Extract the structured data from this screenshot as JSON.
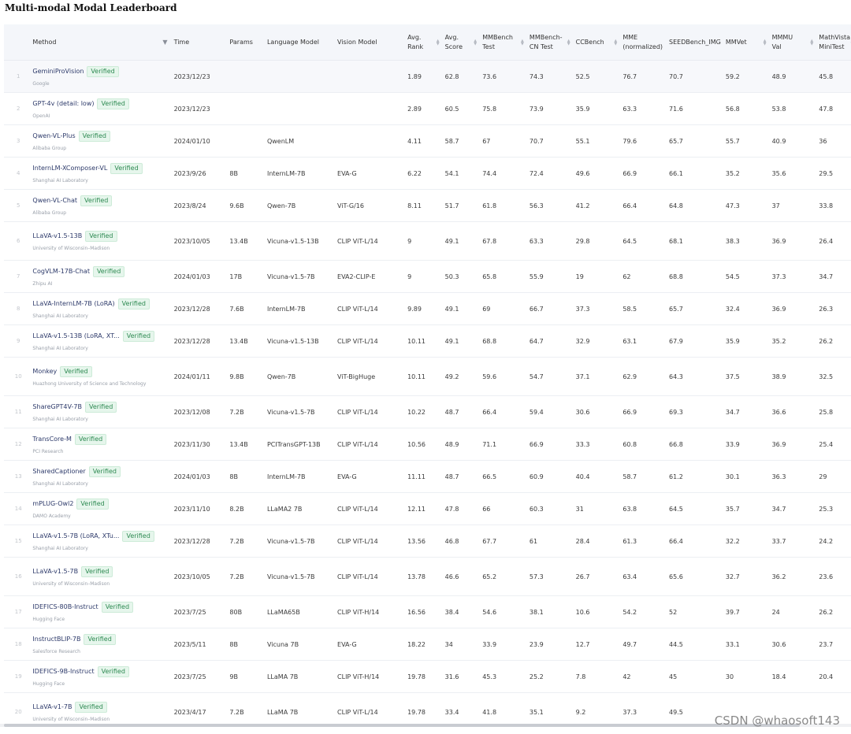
{
  "title": "Multi-modal Modal Leaderboard",
  "columns": [
    {
      "key": "method",
      "label": "Method",
      "filter": true
    },
    {
      "key": "time",
      "label": "Time"
    },
    {
      "key": "params",
      "label": "Params"
    },
    {
      "key": "lm",
      "label": "Language Model"
    },
    {
      "key": "vm",
      "label": "Vision Model"
    },
    {
      "key": "avg_rank",
      "label": "Avg.\nRank",
      "sort": true
    },
    {
      "key": "avg_score",
      "label": "Avg.\nScore",
      "sort": true
    },
    {
      "key": "mmbench",
      "label": "MMBench\nTest",
      "sort": true
    },
    {
      "key": "mmbench_cn",
      "label": "MMBench-\nCN Test",
      "sort": true
    },
    {
      "key": "ccbench",
      "label": "CCBench",
      "sort": true
    },
    {
      "key": "mme",
      "label": "MME\n(normalized)"
    },
    {
      "key": "seedbench",
      "label": "SEEDBench_IMG"
    },
    {
      "key": "mmvet",
      "label": "MMVet",
      "sort": true
    },
    {
      "key": "mmmu",
      "label": "MMMU\nVal",
      "sort": true
    },
    {
      "key": "mathvista",
      "label": "MathVista\nMiniTest",
      "sort": true
    }
  ],
  "verified_label": "Verified",
  "rows": [
    {
      "idx": "1",
      "name": "GeminiProVision",
      "org": "Google",
      "time": "2023/12/23",
      "params": "",
      "lm": "",
      "vm": "",
      "avg_rank": "1.89",
      "avg_score": "62.8",
      "mmbench": "73.6",
      "mmbench_cn": "74.3",
      "ccbench": "52.5",
      "mme": "76.7",
      "seedbench": "70.7",
      "mmvet": "59.2",
      "mmmu": "48.9",
      "mathvista": "45.8"
    },
    {
      "idx": "2",
      "name": "GPT-4v (detail: low)",
      "org": "OpenAI",
      "time": "2023/12/23",
      "params": "",
      "lm": "",
      "vm": "",
      "avg_rank": "2.89",
      "avg_score": "60.5",
      "mmbench": "75.8",
      "mmbench_cn": "73.9",
      "ccbench": "35.9",
      "mme": "63.3",
      "seedbench": "71.6",
      "mmvet": "56.8",
      "mmmu": "53.8",
      "mathvista": "47.8"
    },
    {
      "idx": "3",
      "name": "Qwen-VL-Plus",
      "org": "Alibaba Group",
      "time": "2024/01/10",
      "params": "",
      "lm": "QwenLM",
      "vm": "",
      "avg_rank": "4.11",
      "avg_score": "58.7",
      "mmbench": "67",
      "mmbench_cn": "70.7",
      "ccbench": "55.1",
      "mme": "79.6",
      "seedbench": "65.7",
      "mmvet": "55.7",
      "mmmu": "40.9",
      "mathvista": "36"
    },
    {
      "idx": "4",
      "name": "InternLM-XComposer-VL",
      "org": "Shanghai AI Laboratory",
      "time": "2023/9/26",
      "params": "8B",
      "lm": "InternLM-7B",
      "vm": "EVA-G",
      "avg_rank": "6.22",
      "avg_score": "54.1",
      "mmbench": "74.4",
      "mmbench_cn": "72.4",
      "ccbench": "49.6",
      "mme": "66.9",
      "seedbench": "66.1",
      "mmvet": "35.2",
      "mmmu": "35.6",
      "mathvista": "29.5"
    },
    {
      "idx": "5",
      "name": "Qwen-VL-Chat",
      "org": "Alibaba Group",
      "time": "2023/8/24",
      "params": "9.6B",
      "lm": "Qwen-7B",
      "vm": "ViT-G/16",
      "avg_rank": "8.11",
      "avg_score": "51.7",
      "mmbench": "61.8",
      "mmbench_cn": "56.3",
      "ccbench": "41.2",
      "mme": "66.4",
      "seedbench": "64.8",
      "mmvet": "47.3",
      "mmmu": "37",
      "mathvista": "33.8"
    },
    {
      "idx": "6",
      "name": "LLaVA-v1.5-13B",
      "org": "University of Wisconsin–Madison",
      "time": "2023/10/05",
      "params": "13.4B",
      "lm": "Vicuna-v1.5-13B",
      "vm": "CLIP ViT-L/14",
      "avg_rank": "9",
      "avg_score": "49.1",
      "mmbench": "67.8",
      "mmbench_cn": "63.3",
      "ccbench": "29.8",
      "mme": "64.5",
      "seedbench": "68.1",
      "mmvet": "38.3",
      "mmmu": "36.9",
      "mathvista": "26.4",
      "tall": true
    },
    {
      "idx": "7",
      "name": "CogVLM-17B-Chat",
      "org": "Zhipu AI",
      "time": "2024/01/03",
      "params": "17B",
      "lm": "Vicuna-v1.5-7B",
      "vm": "EVA2-CLIP-E",
      "avg_rank": "9",
      "avg_score": "50.3",
      "mmbench": "65.8",
      "mmbench_cn": "55.9",
      "ccbench": "19",
      "mme": "62",
      "seedbench": "68.8",
      "mmvet": "54.5",
      "mmmu": "37.3",
      "mathvista": "34.7"
    },
    {
      "idx": "8",
      "name": "LLaVA-InternLM-7B (LoRA)",
      "org": "Shanghai AI Laboratory",
      "time": "2023/12/28",
      "params": "7.6B",
      "lm": "InternLM-7B",
      "vm": "CLIP ViT-L/14",
      "avg_rank": "9.89",
      "avg_score": "49.1",
      "mmbench": "69",
      "mmbench_cn": "66.7",
      "ccbench": "37.3",
      "mme": "58.5",
      "seedbench": "65.7",
      "mmvet": "32.4",
      "mmmu": "36.9",
      "mathvista": "26.3"
    },
    {
      "idx": "9",
      "name": "LLaVA-v1.5-13B (LoRA, XT...",
      "org": "Shanghai AI Laboratory",
      "time": "2023/12/28",
      "params": "13.4B",
      "lm": "Vicuna-v1.5-13B",
      "vm": "CLIP ViT-L/14",
      "avg_rank": "10.11",
      "avg_score": "49.1",
      "mmbench": "68.8",
      "mmbench_cn": "64.7",
      "ccbench": "32.9",
      "mme": "63.1",
      "seedbench": "67.9",
      "mmvet": "35.9",
      "mmmu": "35.2",
      "mathvista": "26.2"
    },
    {
      "idx": "10",
      "name": "Monkey",
      "org": "Huazhong University of Science and Technology",
      "time": "2024/01/11",
      "params": "9.8B",
      "lm": "Qwen-7B",
      "vm": "ViT-BigHuge",
      "avg_rank": "10.11",
      "avg_score": "49.2",
      "mmbench": "59.6",
      "mmbench_cn": "54.7",
      "ccbench": "37.1",
      "mme": "62.9",
      "seedbench": "64.3",
      "mmvet": "37.5",
      "mmmu": "38.9",
      "mathvista": "32.5",
      "tall": true
    },
    {
      "idx": "11",
      "name": "ShareGPT4V-7B",
      "org": "Shanghai AI Laboratory",
      "time": "2023/12/08",
      "params": "7.2B",
      "lm": "Vicuna-v1.5-7B",
      "vm": "CLIP ViT-L/14",
      "avg_rank": "10.22",
      "avg_score": "48.7",
      "mmbench": "66.4",
      "mmbench_cn": "59.4",
      "ccbench": "30.6",
      "mme": "66.9",
      "seedbench": "69.3",
      "mmvet": "34.7",
      "mmmu": "36.6",
      "mathvista": "25.8"
    },
    {
      "idx": "12",
      "name": "TransCore-M",
      "org": "PCI Research",
      "time": "2023/11/30",
      "params": "13.4B",
      "lm": "PCITransGPT-13B",
      "vm": "CLIP ViT-L/14",
      "avg_rank": "10.56",
      "avg_score": "48.9",
      "mmbench": "71.1",
      "mmbench_cn": "66.9",
      "ccbench": "33.3",
      "mme": "60.8",
      "seedbench": "66.8",
      "mmvet": "33.9",
      "mmmu": "36.9",
      "mathvista": "25.4"
    },
    {
      "idx": "13",
      "name": "SharedCaptioner",
      "org": "Shanghai AI Laboratory",
      "time": "2024/01/03",
      "params": "8B",
      "lm": "InternLM-7B",
      "vm": "EVA-G",
      "avg_rank": "11.11",
      "avg_score": "48.7",
      "mmbench": "66.5",
      "mmbench_cn": "60.9",
      "ccbench": "40.4",
      "mme": "58.7",
      "seedbench": "61.2",
      "mmvet": "30.1",
      "mmmu": "36.3",
      "mathvista": "29"
    },
    {
      "idx": "14",
      "name": "mPLUG-Owl2",
      "org": "DAMO Academy",
      "time": "2023/11/10",
      "params": "8.2B",
      "lm": "LLaMA2 7B",
      "vm": "CLIP ViT-L/14",
      "avg_rank": "12.11",
      "avg_score": "47.8",
      "mmbench": "66",
      "mmbench_cn": "60.3",
      "ccbench": "31",
      "mme": "63.8",
      "seedbench": "64.5",
      "mmvet": "35.7",
      "mmmu": "34.7",
      "mathvista": "25.3"
    },
    {
      "idx": "15",
      "name": "LLaVA-v1.5-7B (LoRA, XTu...",
      "org": "Shanghai AI Laboratory",
      "time": "2023/12/28",
      "params": "7.2B",
      "lm": "Vicuna-v1.5-7B",
      "vm": "CLIP ViT-L/14",
      "avg_rank": "13.56",
      "avg_score": "46.8",
      "mmbench": "67.7",
      "mmbench_cn": "61",
      "ccbench": "28.4",
      "mme": "61.3",
      "seedbench": "66.4",
      "mmvet": "32.2",
      "mmmu": "33.7",
      "mathvista": "24.2"
    },
    {
      "idx": "16",
      "name": "LLaVA-v1.5-7B",
      "org": "University of Wisconsin–Madison",
      "time": "2023/10/05",
      "params": "7.2B",
      "lm": "Vicuna-v1.5-7B",
      "vm": "CLIP ViT-L/14",
      "avg_rank": "13.78",
      "avg_score": "46.6",
      "mmbench": "65.2",
      "mmbench_cn": "57.3",
      "ccbench": "26.7",
      "mme": "63.4",
      "seedbench": "65.6",
      "mmvet": "32.7",
      "mmmu": "36.2",
      "mathvista": "23.6",
      "tall": true
    },
    {
      "idx": "17",
      "name": "IDEFICS-80B-Instruct",
      "org": "Hugging Face",
      "time": "2023/7/25",
      "params": "80B",
      "lm": "LLaMA65B",
      "vm": "CLIP ViT-H/14",
      "avg_rank": "16.56",
      "avg_score": "38.4",
      "mmbench": "54.6",
      "mmbench_cn": "38.1",
      "ccbench": "10.6",
      "mme": "54.2",
      "seedbench": "52",
      "mmvet": "39.7",
      "mmmu": "24",
      "mathvista": "26.2"
    },
    {
      "idx": "18",
      "name": "InstructBLIP-7B",
      "org": "Salesforce Research",
      "time": "2023/5/11",
      "params": "8B",
      "lm": "Vicuna 7B",
      "vm": "EVA-G",
      "avg_rank": "18.22",
      "avg_score": "34",
      "mmbench": "33.9",
      "mmbench_cn": "23.9",
      "ccbench": "12.7",
      "mme": "49.7",
      "seedbench": "44.5",
      "mmvet": "33.1",
      "mmmu": "30.6",
      "mathvista": "23.7"
    },
    {
      "idx": "19",
      "name": "IDEFICS-9B-Instruct",
      "org": "Hugging Face",
      "time": "2023/7/25",
      "params": "9B",
      "lm": "LLaMA 7B",
      "vm": "CLIP ViT-H/14",
      "avg_rank": "19.78",
      "avg_score": "31.6",
      "mmbench": "45.3",
      "mmbench_cn": "25.2",
      "ccbench": "7.8",
      "mme": "42",
      "seedbench": "45",
      "mmvet": "30",
      "mmmu": "18.4",
      "mathvista": "20.4"
    },
    {
      "idx": "20",
      "name": "LLaVA-v1-7B",
      "org": "University of Wisconsin–Madison",
      "time": "2023/4/17",
      "params": "7.2B",
      "lm": "LLaMA 7B",
      "vm": "CLIP ViT-L/14",
      "avg_rank": "19.78",
      "avg_score": "33.4",
      "mmbench": "41.8",
      "mmbench_cn": "35.1",
      "ccbench": "9.2",
      "mme": "37.3",
      "seedbench": "49.5",
      "mmvet": "",
      "mmmu": "",
      "mathvista": "",
      "tall": true
    }
  ],
  "watermark": "CSDN @whaosoft143"
}
